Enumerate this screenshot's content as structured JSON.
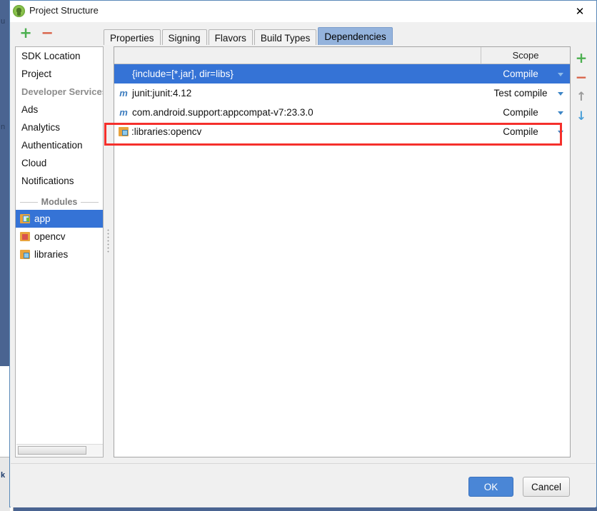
{
  "window": {
    "title": "Project Structure",
    "icon": "android-studio-icon",
    "close_label": "✕"
  },
  "toolbar": {
    "add_label": "+",
    "remove_label": "−"
  },
  "tabs": [
    {
      "label": "Properties",
      "selected": false
    },
    {
      "label": "Signing",
      "selected": false
    },
    {
      "label": "Flavors",
      "selected": false
    },
    {
      "label": "Build Types",
      "selected": false
    },
    {
      "label": "Dependencies",
      "selected": true
    }
  ],
  "sidebar": {
    "items": [
      {
        "label": "SDK Location",
        "type": "item",
        "selected": false
      },
      {
        "label": "Project",
        "type": "item",
        "selected": false
      },
      {
        "label": "Developer Services",
        "type": "header",
        "selected": false
      },
      {
        "label": "Ads",
        "type": "item",
        "selected": false
      },
      {
        "label": "Analytics",
        "type": "item",
        "selected": false
      },
      {
        "label": "Authentication",
        "type": "item",
        "selected": false
      },
      {
        "label": "Cloud",
        "type": "item",
        "selected": false
      },
      {
        "label": "Notifications",
        "type": "item",
        "selected": false
      }
    ],
    "modules_separator": "Modules",
    "modules": [
      {
        "label": "app",
        "icon": "app-module-icon",
        "selected": true
      },
      {
        "label": "opencv",
        "icon": "library-module-icon",
        "selected": false
      },
      {
        "label": "libraries",
        "icon": "folder-module-icon",
        "selected": false
      }
    ]
  },
  "dependencies_table": {
    "columns": [
      "",
      "Scope"
    ],
    "rows": [
      {
        "icon": "none",
        "name": "{include=[*.jar], dir=libs}",
        "scope": "Compile",
        "selected": true,
        "highlighted": false
      },
      {
        "icon": "maven-icon",
        "icon_glyph": "m",
        "name": "junit:junit:4.12",
        "scope": "Test compile",
        "selected": false,
        "highlighted": false
      },
      {
        "icon": "maven-icon",
        "icon_glyph": "m",
        "name": "com.android.support:appcompat-v7:23.3.0",
        "scope": "Compile",
        "selected": false,
        "highlighted": false
      },
      {
        "icon": "module-icon",
        "name": ":libraries:opencv",
        "scope": "Compile",
        "selected": false,
        "highlighted": true
      }
    ]
  },
  "side_tools": {
    "add_label": "+",
    "remove_label": "−",
    "move_up_label": "↑",
    "move_down_label": "↓"
  },
  "footer": {
    "ok_label": "OK",
    "cancel_label": "Cancel"
  },
  "background": {
    "fragments": [
      "u",
      "n",
      "k"
    ]
  },
  "colors": {
    "selection_blue": "#3573d6",
    "tab_selected": "#94b3dc",
    "annotation_red": "#f5302c",
    "ok_button": "#4a86d6",
    "maven_icon": "#3d7dbf",
    "ide_background": "#4a6491"
  }
}
